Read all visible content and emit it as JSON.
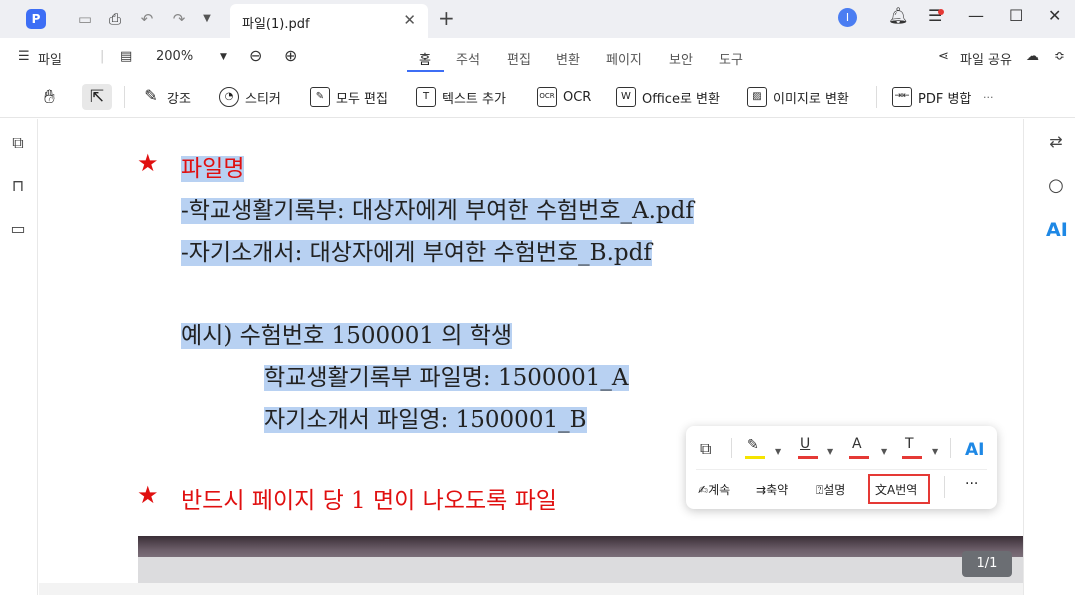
{
  "titlebar": {
    "app_logo": "P",
    "tab_title": "파일(1).pdf",
    "avatar_initial": "I"
  },
  "menubar": {
    "file_menu": "파일",
    "zoom": "200%",
    "tabs": [
      "홈",
      "주석",
      "편집",
      "변환",
      "페이지",
      "보안",
      "도구"
    ],
    "active_tab": "홈",
    "share": "파일 공유"
  },
  "toolbar": {
    "highlight": "강조",
    "sticker": "스티커",
    "edit_all": "모두 편집",
    "add_text": "텍스트 추가",
    "ocr": "OCR",
    "to_office": "Office로 변환",
    "to_image": "이미지로 변환",
    "pdf_merge": "PDF 병합",
    "more": "···"
  },
  "document": {
    "line1": "파일명",
    "line2": "-학교생활기록부: 대상자에게 부여한 수험번호_A.pdf",
    "line3": "-자기소개서: 대상자에게 부여한 수험번호_B.pdf",
    "line4": "예시) 수험번호 1500001 의 학생",
    "line5": "학교생활기록부 파일명: 1500001_A",
    "line6": "자기소개서 파일영: 1500001_B",
    "line7": "반드시 페이지 당 1 면이 나오도록 파일",
    "star": "★"
  },
  "popup": {
    "continue": "계속",
    "summarize": "축약",
    "explain": "설명",
    "translate": "번역",
    "more": "···",
    "ai": "AI",
    "colors": {
      "highlight": "#f5e400",
      "underline": "#e53935",
      "strike": "#e53935",
      "text": "#e53935"
    }
  },
  "page_indicator": "1/1",
  "right_sidebar": {
    "ai": "AI"
  }
}
